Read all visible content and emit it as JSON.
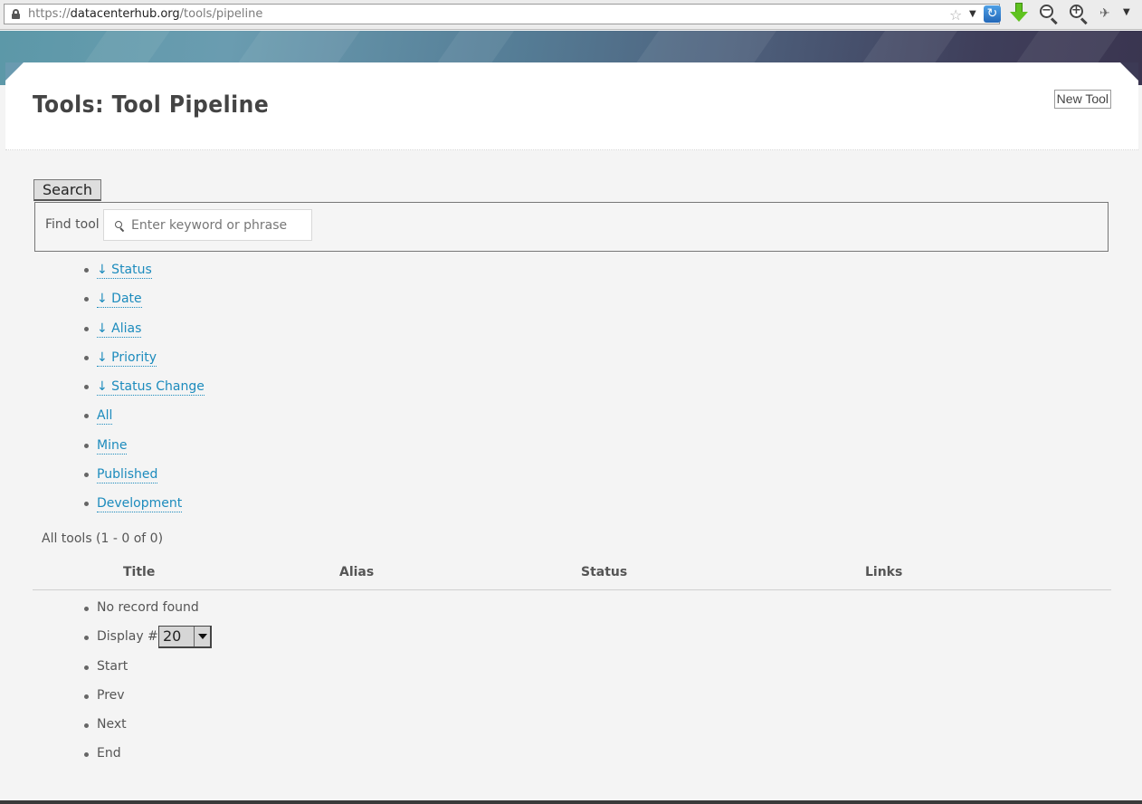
{
  "browser": {
    "url_scheme": "https://",
    "url_host": "datacenterhub.org",
    "url_path": "/tools/pipeline",
    "icons": [
      "lock-icon",
      "star-icon",
      "reload-icon",
      "download-icon",
      "zoom-out-icon",
      "zoom-in-icon",
      "tools-icon",
      "menu-icon"
    ],
    "zoom_out_sign": "−",
    "zoom_in_sign": "+"
  },
  "header": {
    "title": "Tools: Tool Pipeline",
    "new_tool_label": "New Tool"
  },
  "search": {
    "legend": "Search",
    "find_label": "Find tool",
    "placeholder": "Enter keyword or phrase",
    "value": ""
  },
  "filters": [
    {
      "label": "↓ Status"
    },
    {
      "label": "↓ Date"
    },
    {
      "label": "↓ Alias"
    },
    {
      "label": "↓ Priority"
    },
    {
      "label": "↓ Status Change"
    },
    {
      "label": "All"
    },
    {
      "label": "Mine"
    },
    {
      "label": "Published"
    },
    {
      "label": "Development"
    }
  ],
  "listing": {
    "count_label": "All tools (1 - 0 of 0)",
    "columns": [
      "Title",
      "Alias",
      "Status",
      "Links"
    ]
  },
  "pager": {
    "empty_message": "No record found",
    "display_label": "Display #",
    "display_value": "20",
    "start": "Start",
    "prev": "Prev",
    "next": "Next",
    "end": "End"
  },
  "colors": {
    "link": "#1c8bbd",
    "text": "#555555",
    "banner_left": "#5c98a8",
    "banner_right": "#3a3550"
  }
}
